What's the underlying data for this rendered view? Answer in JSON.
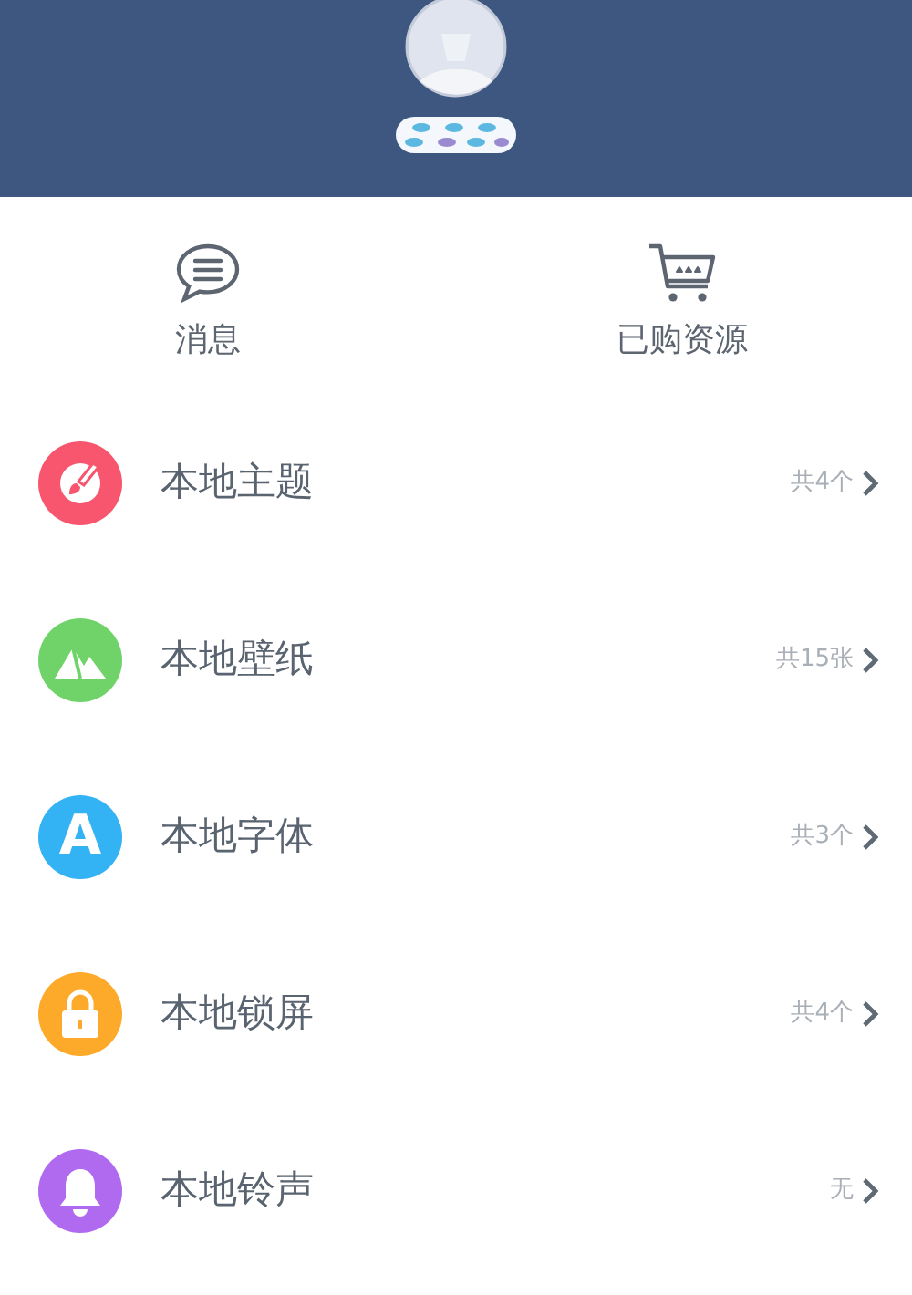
{
  "quick_actions": [
    {
      "kind": "message",
      "label": "消息"
    },
    {
      "kind": "cart",
      "label": "已购资源"
    }
  ],
  "items": [
    {
      "kind": "brush",
      "color": "#f7566e",
      "title": "本地主题",
      "count": "共4个"
    },
    {
      "kind": "mountains",
      "color": "#6fd36a",
      "title": "本地壁纸",
      "count": "共15张"
    },
    {
      "kind": "letter",
      "color": "#33b2f4",
      "glyph": "A",
      "title": "本地字体",
      "count": "共3个"
    },
    {
      "kind": "lock",
      "color": "#fdaa2a",
      "title": "本地锁屏",
      "count": "共4个"
    },
    {
      "kind": "bell",
      "color": "#b06af0",
      "title": "本地铃声",
      "count": "无"
    }
  ]
}
